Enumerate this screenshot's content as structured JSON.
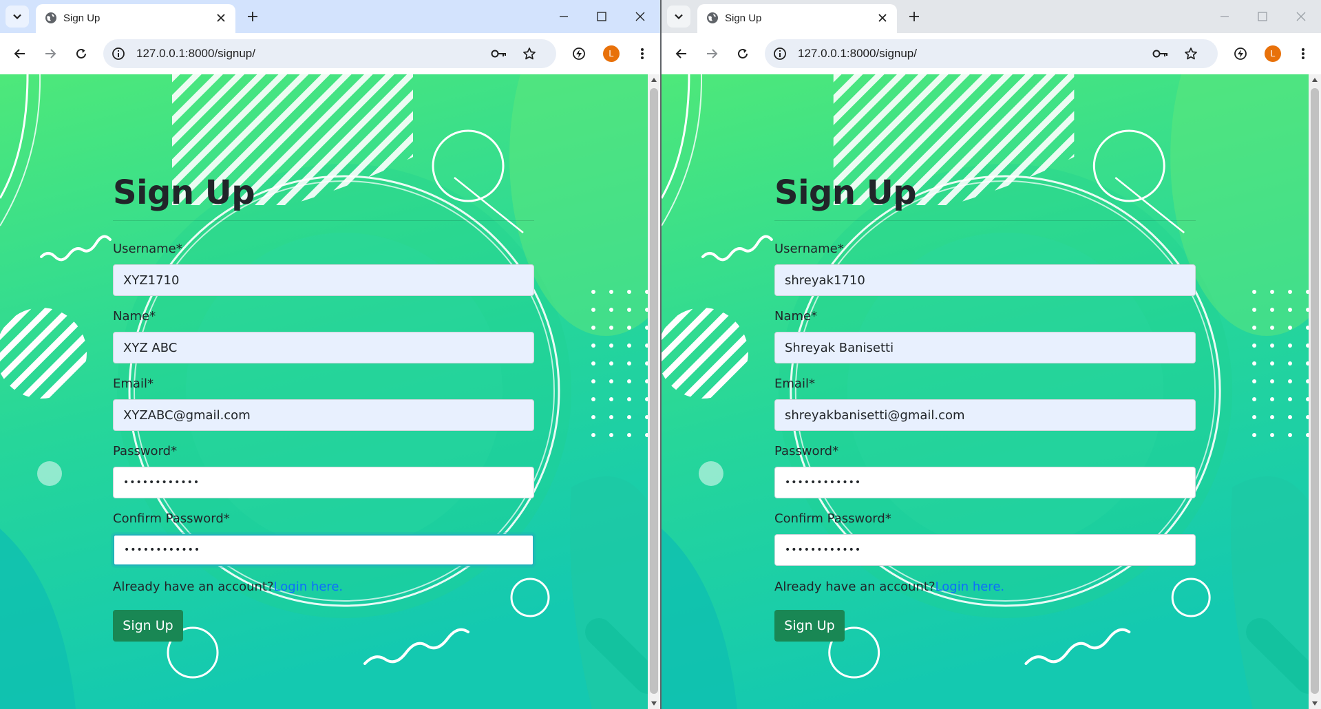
{
  "windows": [
    {
      "tab_title": "Sign Up",
      "url": "127.0.0.1:8000/signup/",
      "profile_initial": "L",
      "form": {
        "title": "Sign Up",
        "username_label": "Username*",
        "username_value": "XYZ1710",
        "name_label": "Name*",
        "name_value": "XYZ ABC",
        "email_label": "Email*",
        "email_value": "XYZABC@gmail.com",
        "password_label": "Password*",
        "password_value": "••••••••••••",
        "confirm_label": "Confirm Password*",
        "confirm_value": "••••••••••••",
        "login_prompt": "Already have an account?",
        "login_link": "Login here.",
        "submit_label": "Sign Up"
      }
    },
    {
      "tab_title": "Sign Up",
      "url": "127.0.0.1:8000/signup/",
      "profile_initial": "L",
      "form": {
        "title": "Sign Up",
        "username_label": "Username*",
        "username_value": "shreyak1710",
        "name_label": "Name*",
        "name_value": "Shreyak Banisetti",
        "email_label": "Email*",
        "email_value": "shreyakbanisetti@gmail.com",
        "password_label": "Password*",
        "password_value": "••••••••••••",
        "confirm_label": "Confirm Password*",
        "confirm_value": "••••••••••••",
        "login_prompt": "Already have an account?",
        "login_link": "Login here.",
        "submit_label": "Sign Up"
      }
    }
  ],
  "colors": {
    "background_gradient_top": "#4ee87a",
    "background_gradient_bottom": "#14c9b0",
    "submit_button": "#198754",
    "link": "#0d6efd",
    "active_tabstrip": "#d3e3fd",
    "inactive_tabstrip": "#e3e6ea",
    "avatar": "#e8710a"
  },
  "icons": [
    "tab-search-icon",
    "globe-favicon-icon",
    "close-icon",
    "plus-icon",
    "minimize-icon",
    "maximize-icon",
    "back-arrow-icon",
    "forward-arrow-icon",
    "reload-icon",
    "site-info-icon",
    "password-key-icon",
    "bookmark-star-icon",
    "performance-icon",
    "kebab-menu-icon"
  ]
}
